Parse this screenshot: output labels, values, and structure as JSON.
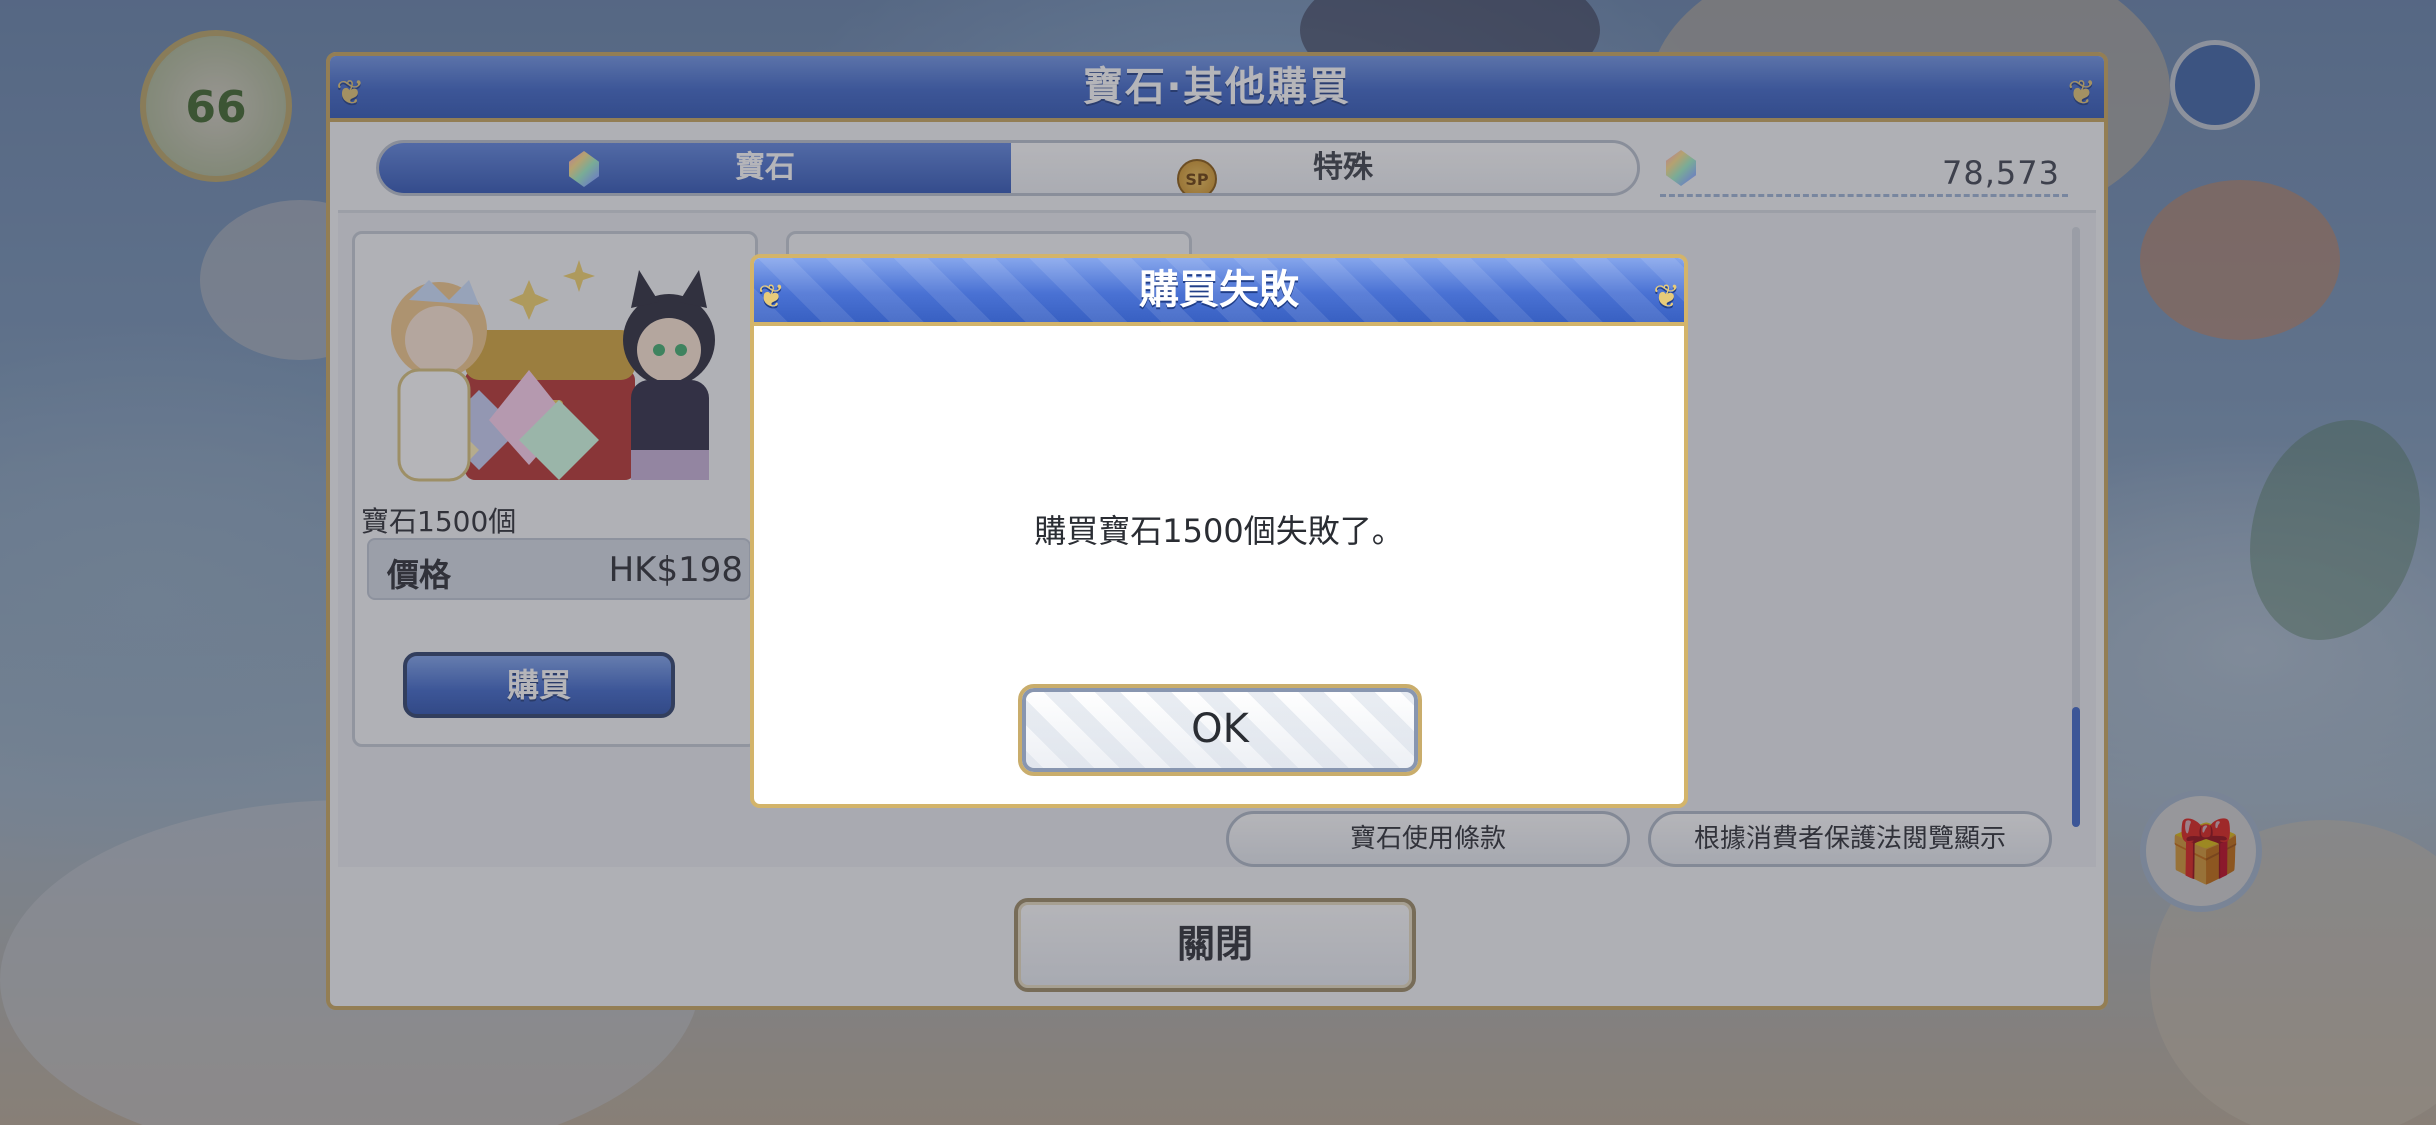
{
  "background": {
    "level_value": "66"
  },
  "store": {
    "title": "寶石‧其他購買",
    "tabs": [
      {
        "label": "寶石",
        "icon": "gem-icon",
        "selected": true
      },
      {
        "label": "特殊",
        "icon": "sp-icon",
        "icon_text": "SP",
        "selected": false
      }
    ],
    "gem_balance": "78,573",
    "product": {
      "name": "寶石1500個",
      "price_label": "價格",
      "price_value": "HK$198",
      "buy_label": "購買"
    },
    "terms_label": "寶石使用條款",
    "consumer_law_label": "根據消費者保護法閱覽顯示",
    "close_label": "關閉"
  },
  "dialog": {
    "title": "購買失敗",
    "message": "購買寶石1500個失敗了。",
    "ok_label": "OK"
  },
  "colors": {
    "accent_blue": "#3d66c9",
    "gold_border": "#d3b46a",
    "panel_bg": "#f6f7f9"
  }
}
